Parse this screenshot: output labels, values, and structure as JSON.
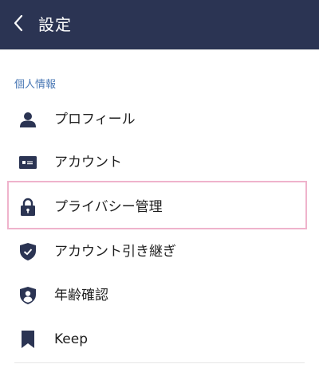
{
  "header": {
    "title": "設定",
    "back_icon": "chevron-left-icon",
    "background": "#2b3453"
  },
  "section": {
    "label": "個人情報",
    "label_color": "#4a78b5"
  },
  "items": [
    {
      "label": "プロフィール",
      "icon": "person-icon"
    },
    {
      "label": "アカウント",
      "icon": "id-card-icon"
    },
    {
      "label": "プライバシー管理",
      "icon": "lock-icon",
      "highlighted": true
    },
    {
      "label": "アカウント引き継ぎ",
      "icon": "shield-check-icon"
    },
    {
      "label": "年齢確認",
      "icon": "shield-person-icon"
    },
    {
      "label": "Keep",
      "icon": "bookmark-icon"
    }
  ],
  "colors": {
    "icon": "#2b3453",
    "highlight_border": "#efb3cc"
  }
}
